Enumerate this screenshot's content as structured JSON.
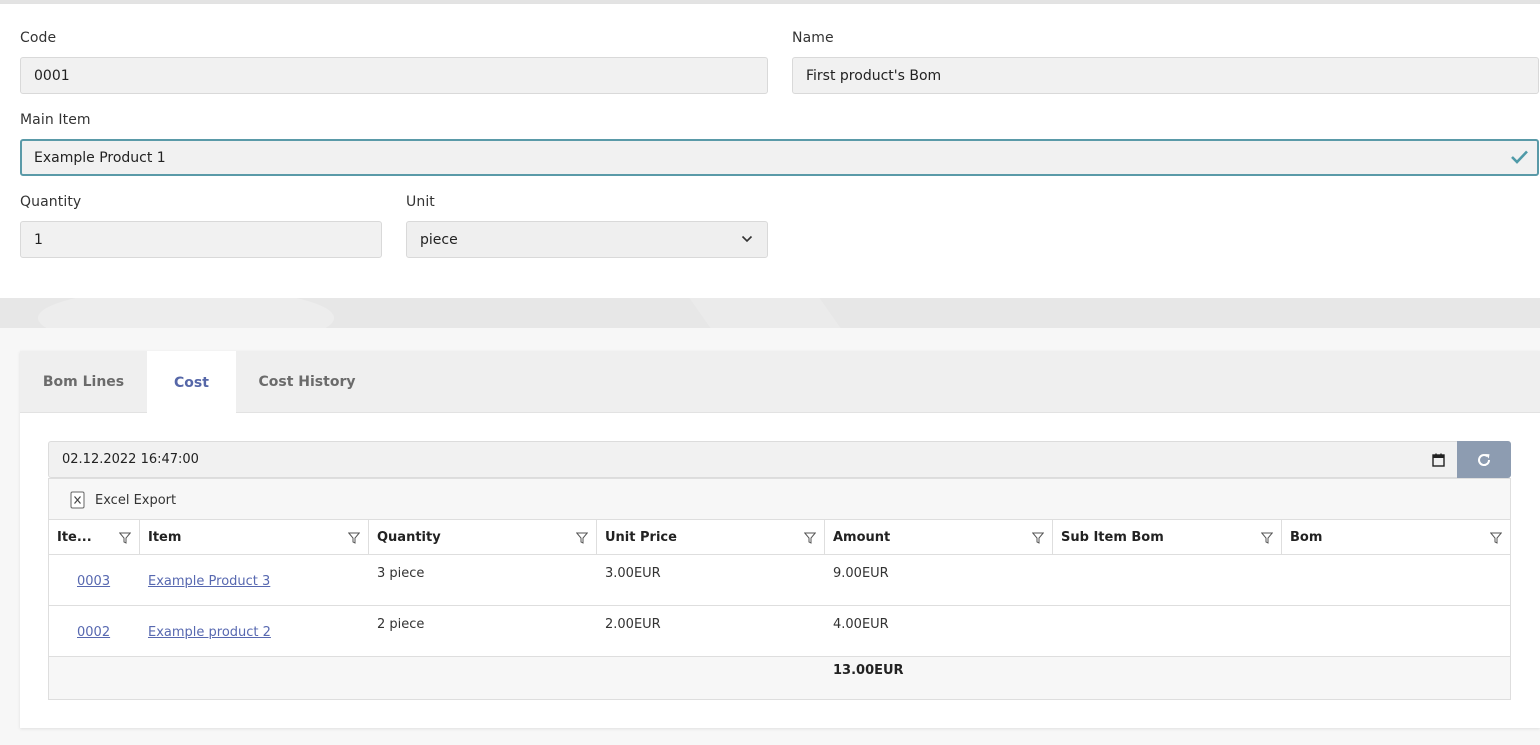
{
  "form": {
    "code_label": "Code",
    "code_value": "0001",
    "name_label": "Name",
    "name_value": "First product's Bom",
    "main_item_label": "Main Item",
    "main_item_value": "Example Product 1",
    "main_item_status_icon": "check-icon",
    "quantity_label": "Quantity",
    "quantity_value": "1",
    "unit_label": "Unit",
    "unit_value": "piece"
  },
  "tabs": [
    {
      "label": "Bom Lines",
      "active": false
    },
    {
      "label": "Cost",
      "active": true
    },
    {
      "label": "Cost History",
      "active": false
    }
  ],
  "cost": {
    "date_value": "02.12.2022 16:47:00",
    "excel_export_label": "Excel Export",
    "columns": [
      "Ite...",
      "Item",
      "Quantity",
      "Unit Price",
      "Amount",
      "Sub Item Bom",
      "Bom"
    ],
    "rows": [
      {
        "code": "0003",
        "item": "Example Product 3",
        "quantity": "3 piece",
        "unit_price": "3.00EUR",
        "amount": "9.00EUR",
        "sub_item_bom": "",
        "bom": ""
      },
      {
        "code": "0002",
        "item": "Example product 2",
        "quantity": "2 piece",
        "unit_price": "2.00EUR",
        "amount": "4.00EUR",
        "sub_item_bom": "",
        "bom": ""
      }
    ],
    "total_amount": "13.00EUR"
  },
  "colors": {
    "accent": "#5667a8",
    "valid_border": "#5a9aa8",
    "refresh_button": "#8d9cb1"
  }
}
